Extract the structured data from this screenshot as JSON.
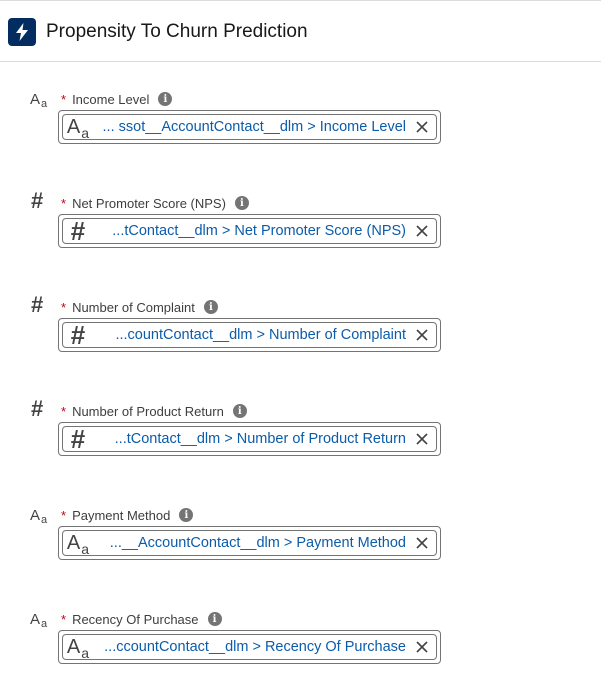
{
  "header": {
    "title": "Propensity To Churn Prediction",
    "icon": "lightning-bolt-icon",
    "icon_color": "#032d60"
  },
  "fields": [
    {
      "type": "text",
      "type_icon": "text-type-icon",
      "label": "Income Level",
      "required": "*",
      "value": "... ssot__AccountContact__dlm > Income Level"
    },
    {
      "type": "number",
      "type_icon": "number-type-icon",
      "label": "Net Promoter Score (NPS)",
      "required": "*",
      "value": "...tContact__dlm > Net Promoter Score (NPS)"
    },
    {
      "type": "number",
      "type_icon": "number-type-icon",
      "label": "Number of Complaint",
      "required": "*",
      "value": "...countContact__dlm > Number of Complaint"
    },
    {
      "type": "number",
      "type_icon": "number-type-icon",
      "label": "Number of Product Return",
      "required": "*",
      "value": "...tContact__dlm > Number of Product Return"
    },
    {
      "type": "text",
      "type_icon": "text-type-icon",
      "label": "Payment Method",
      "required": "*",
      "value": "...__AccountContact__dlm > Payment Method"
    },
    {
      "type": "text",
      "type_icon": "text-type-icon",
      "label": "Recency Of Purchase",
      "required": "*",
      "value": "...ccountContact__dlm > Recency Of Purchase"
    }
  ],
  "colors": {
    "link": "#0b5cab",
    "required": "#ba0517",
    "border": "#747474"
  }
}
